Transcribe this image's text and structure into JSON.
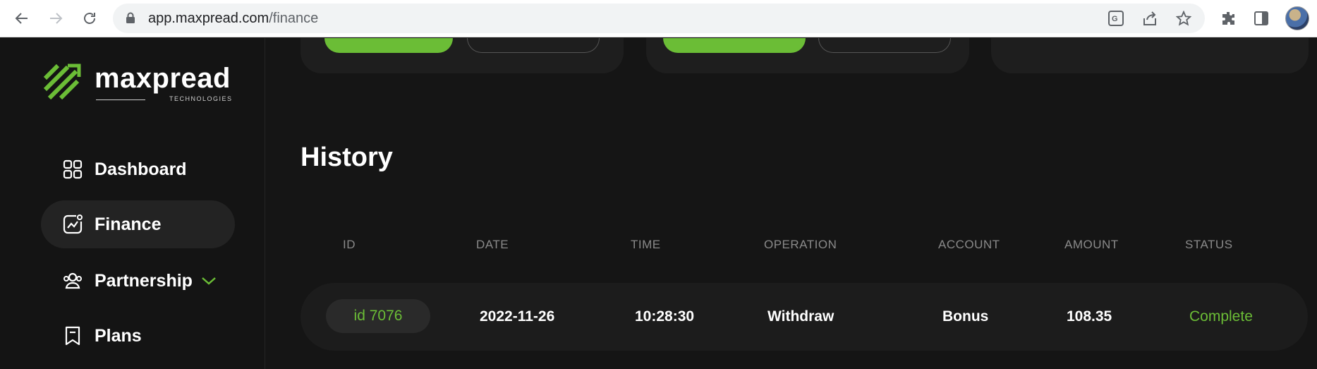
{
  "browser": {
    "url_host": "app.maxpread.com",
    "url_path": "/finance"
  },
  "brand": {
    "name": "maxpread",
    "tagline": "TECHNOLOGIES",
    "accent_color": "#6bbd36"
  },
  "sidebar": {
    "items": [
      {
        "label": "Dashboard",
        "icon": "grid-icon"
      },
      {
        "label": "Finance",
        "icon": "chart-icon",
        "active": true
      },
      {
        "label": "Partnership",
        "icon": "users-icon",
        "has_submenu": true
      },
      {
        "label": "Plans",
        "icon": "bookmark-icon"
      }
    ]
  },
  "history": {
    "title": "History",
    "columns": [
      "ID",
      "DATE",
      "TIME",
      "OPERATION",
      "ACCOUNT",
      "AMOUNT",
      "STATUS"
    ],
    "rows": [
      {
        "id": "id 7076",
        "date": "2022-11-26",
        "time": "10:28:30",
        "operation": "Withdraw",
        "account": "Bonus",
        "amount": "108.35",
        "status": "Complete"
      }
    ]
  }
}
